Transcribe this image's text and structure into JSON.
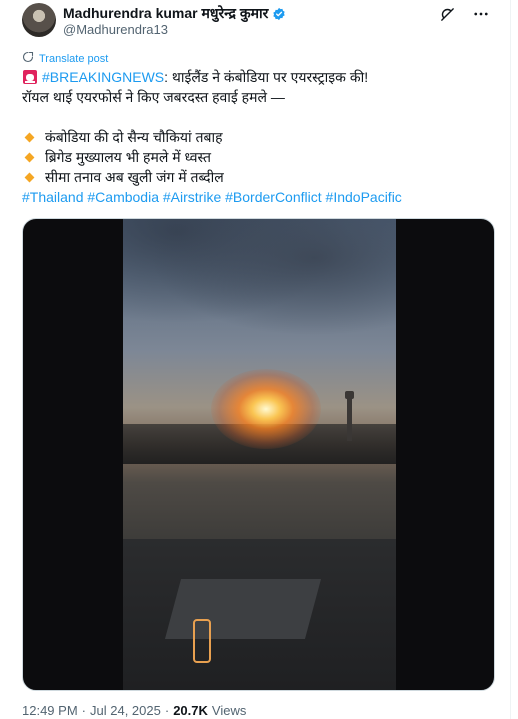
{
  "author": {
    "name": "Madhurendra kumar मधुरेन्द्र कुमार",
    "handle": "@Madhurendra13"
  },
  "translate_label": "Translate post",
  "post": {
    "line1_tag": "#BREAKINGNEWS",
    "line1_rest": ": थाईलैंड ने कंबोडिया पर एयरस्ट्राइक की!",
    "line2": "रॉयल थाई एयरफोर्स ने किए जबरदस्त हवाई हमले —",
    "bullets": [
      "कंबोडिया की दो सैन्य चौकियां तबाह",
      "ब्रिगेड मुख्यालय भी हमले में ध्वस्त",
      "सीमा तनाव अब खुली जंग में तब्दील"
    ],
    "hashtags": [
      "#Thailand",
      "#Cambodia",
      "#Airstrike",
      "#BorderConflict",
      "#IndoPacific"
    ]
  },
  "footer": {
    "time": "12:49 PM",
    "separator": "·",
    "date": "Jul 24, 2025",
    "views_count": "20.7K",
    "views_label": "Views"
  },
  "colors": {
    "link": "#1d9bf0",
    "verified": "#1d9bf0",
    "bullet": "#f5a623",
    "muted": "#536471"
  },
  "icons": {
    "grok": "grok-icon",
    "more": "more-icon",
    "translate": "translate-icon",
    "siren": "siren-icon",
    "verified": "verified-badge-icon"
  }
}
